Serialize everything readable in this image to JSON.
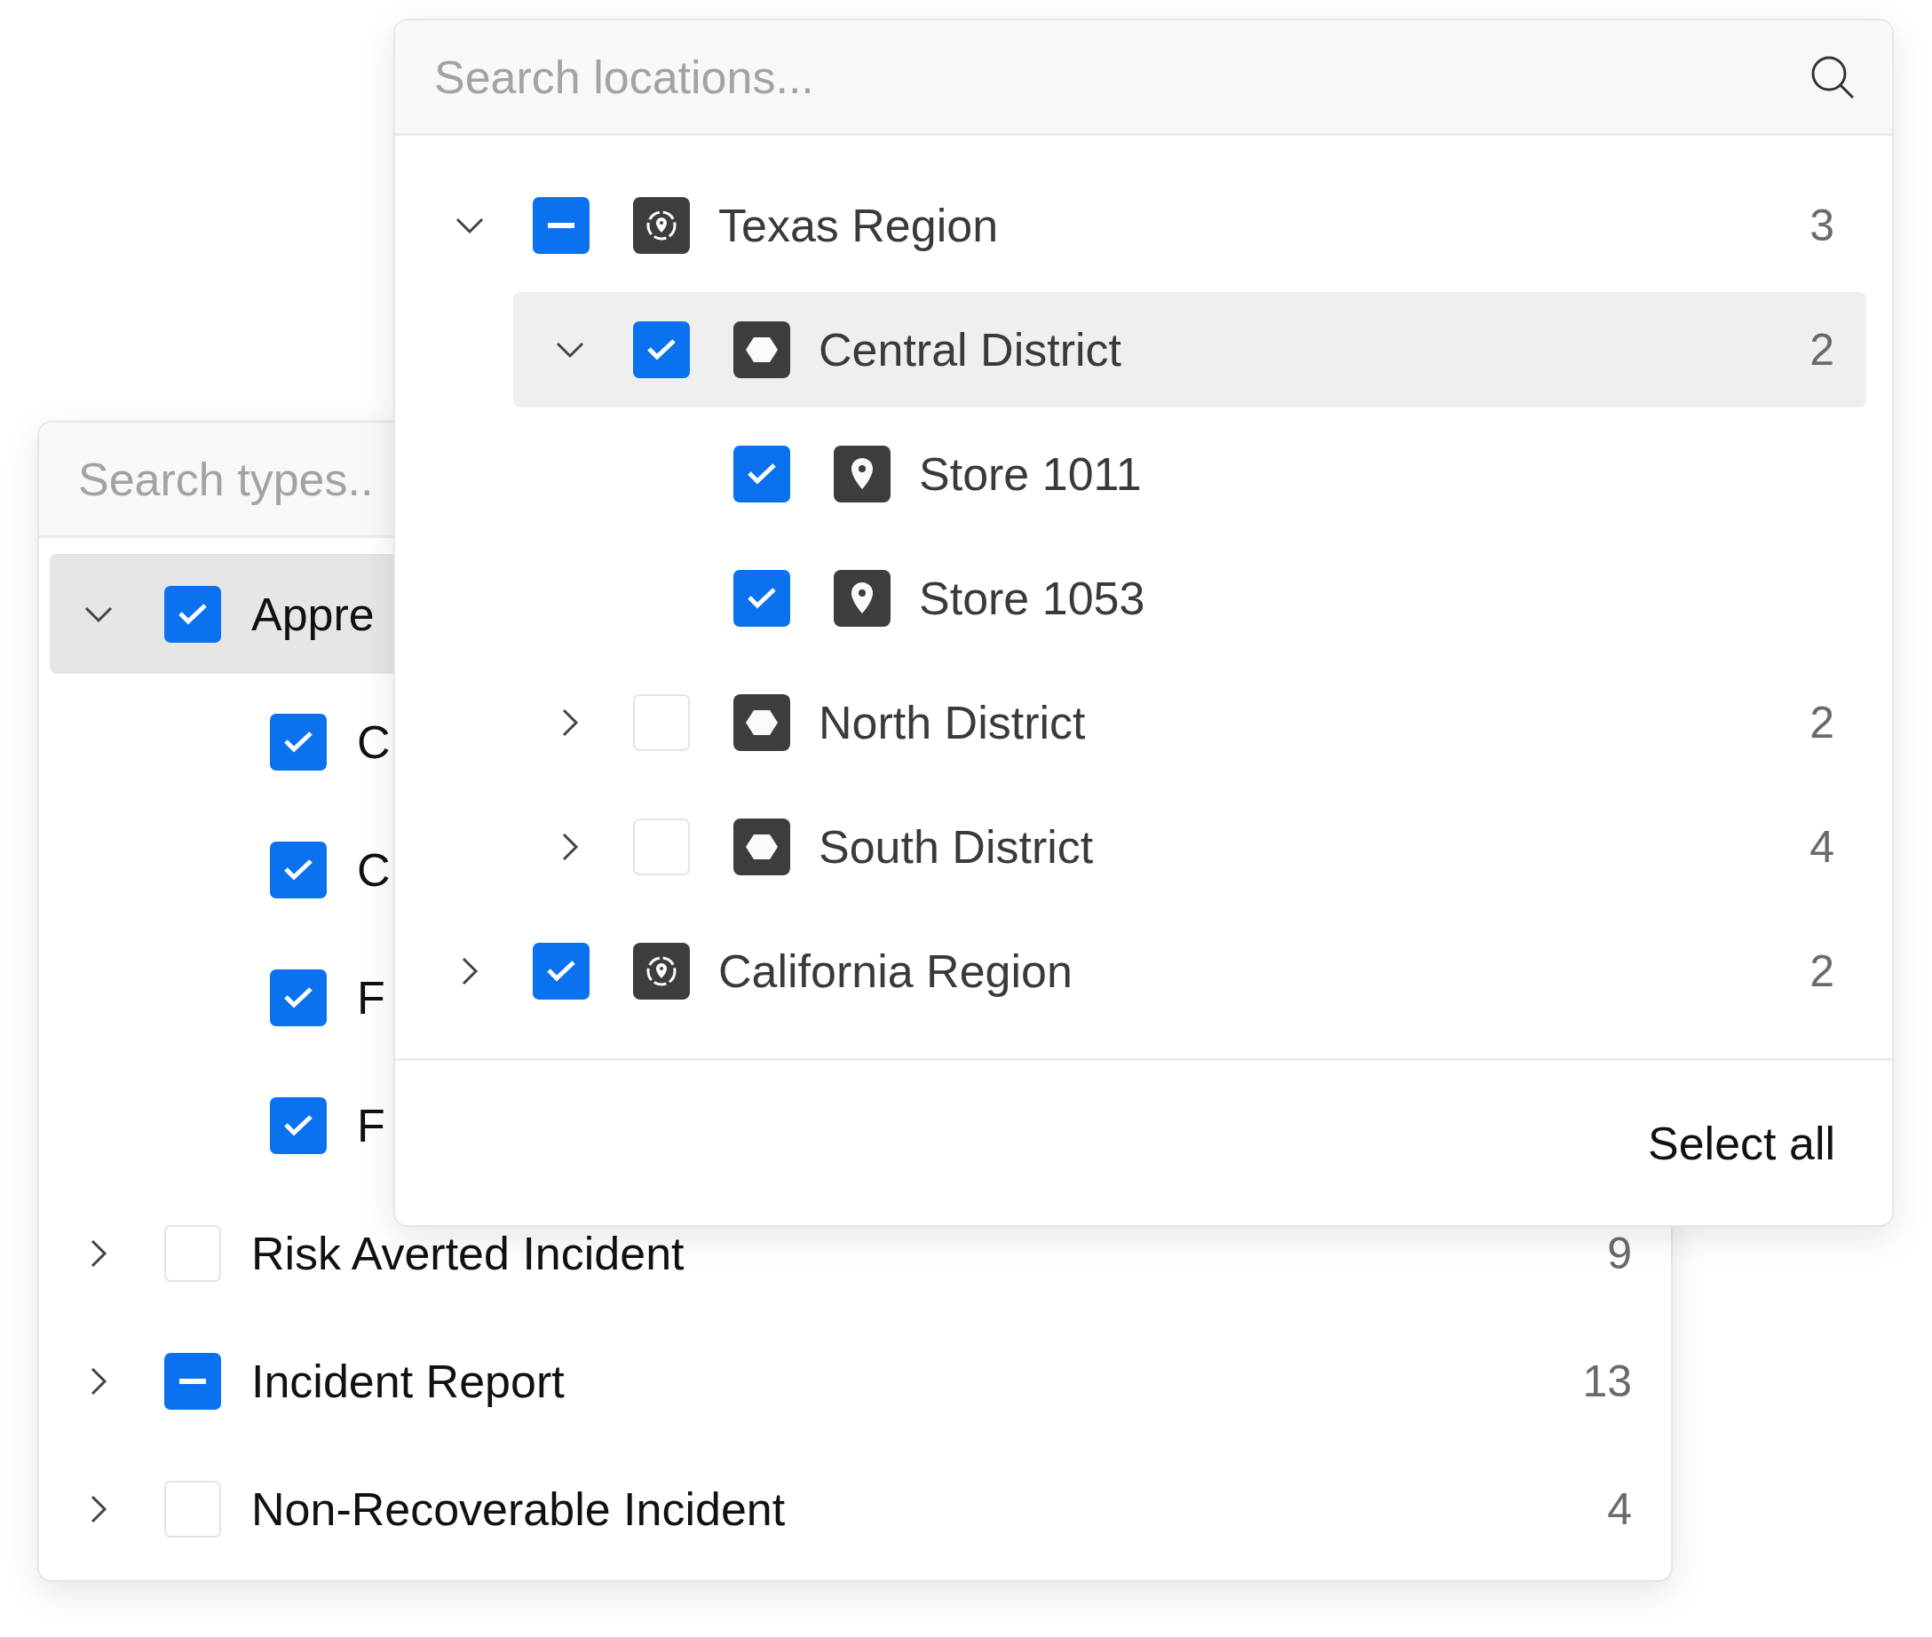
{
  "types_panel": {
    "search": {
      "placeholder": "Search types.."
    },
    "items": [
      {
        "label": "Appre",
        "checked": true,
        "partial": false,
        "expanded": true,
        "highlighted": true,
        "children": [
          {
            "label": "C",
            "checked": true,
            "partial": false,
            "highlighted": false
          },
          {
            "label": "C",
            "checked": true,
            "partial": false,
            "highlighted": false
          },
          {
            "label": "F",
            "checked": true,
            "partial": false,
            "highlighted": false
          },
          {
            "label": "F",
            "checked": true,
            "partial": false,
            "highlighted": false
          }
        ]
      },
      {
        "label": "Risk Averted Incident",
        "count": "9",
        "checked": false,
        "partial": false,
        "expanded": false,
        "highlighted": false
      },
      {
        "label": "Incident Report",
        "count": "13",
        "partial": true,
        "expanded": false,
        "highlighted": false
      },
      {
        "label": "Non-Recoverable Incident",
        "count": "4",
        "checked": false,
        "partial": false,
        "expanded": false,
        "highlighted": false
      }
    ]
  },
  "locations_panel": {
    "search": {
      "placeholder": "Search locations..."
    },
    "items": [
      {
        "label": "Texas Region",
        "kind": "region",
        "count": "3",
        "partial": true,
        "expanded": true,
        "highlighted": false,
        "children": [
          {
            "label": "Central District",
            "kind": "district",
            "count": "2",
            "checked": true,
            "partial": false,
            "expanded": true,
            "highlighted": true,
            "children": [
              {
                "label": "Store 1011",
                "kind": "store",
                "checked": true,
                "partial": false,
                "highlighted": false
              },
              {
                "label": "Store 1053",
                "kind": "store",
                "checked": true,
                "partial": false,
                "highlighted": false
              }
            ]
          },
          {
            "label": "North District",
            "kind": "district",
            "count": "2",
            "checked": false,
            "partial": false,
            "expanded": false,
            "highlighted": false
          },
          {
            "label": "South District",
            "kind": "district",
            "count": "4",
            "checked": false,
            "partial": false,
            "expanded": false,
            "highlighted": false
          }
        ]
      },
      {
        "label": "California Region",
        "kind": "region",
        "count": "2",
        "checked": true,
        "partial": false,
        "expanded": false,
        "highlighted": false
      }
    ],
    "footer": {
      "button": "Select all"
    }
  }
}
